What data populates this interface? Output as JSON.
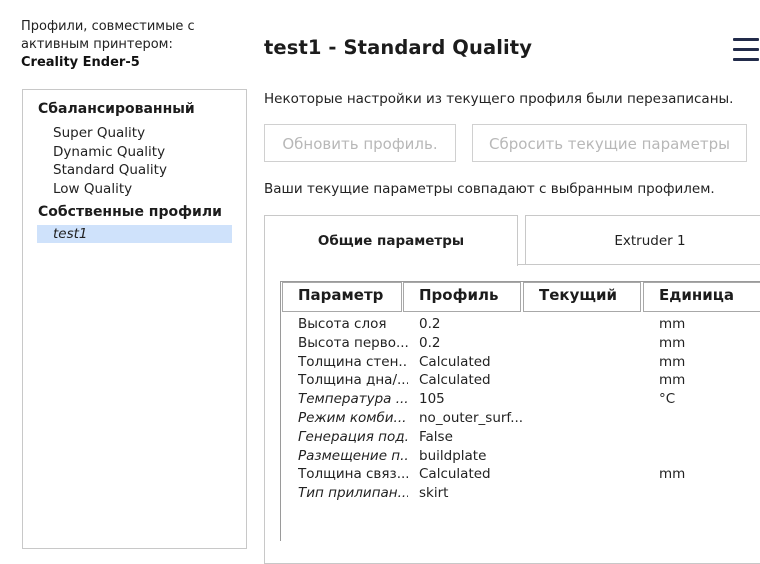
{
  "compat": {
    "line1": "Профили, совместимые с",
    "line2": "активным принтером:",
    "printer": "Creality Ender-5"
  },
  "profiles": {
    "groups": [
      {
        "title": "Сбалансированный",
        "items": [
          "Super Quality",
          "Dynamic Quality",
          "Standard Quality",
          "Low Quality"
        ]
      },
      {
        "title": "Собственные профили",
        "items": [
          "test1"
        ]
      }
    ],
    "selected": "test1"
  },
  "header": {
    "title": "test1 - Standard Quality",
    "menu_icon": "hamburger-menu-icon"
  },
  "notice": "Некоторые настройки из текущего профиля были перезаписаны.",
  "buttons": {
    "update": "Обновить профиль.",
    "reset": "Сбросить текущие параметры"
  },
  "match_text": "Ваши текущие параметры совпадают с выбранным профилем.",
  "tabs": [
    {
      "label": "Общие параметры",
      "active": true
    },
    {
      "label": "Extruder 1",
      "active": false
    }
  ],
  "table": {
    "headers": [
      "Параметр",
      "Профиль",
      "Текущий",
      "Единица"
    ],
    "rows": [
      {
        "param": "Высота слоя",
        "profile": "0.2",
        "current": "",
        "unit": "mm",
        "italic": false
      },
      {
        "param": "Высота перво...",
        "profile": "0.2",
        "current": "",
        "unit": "mm",
        "italic": false
      },
      {
        "param": "Толщина стен...",
        "profile": "Calculated",
        "current": "",
        "unit": "mm",
        "italic": false
      },
      {
        "param": "Толщина дна/...",
        "profile": "Calculated",
        "current": "",
        "unit": "mm",
        "italic": false
      },
      {
        "param": "Температура ...",
        "profile": "105",
        "current": "",
        "unit": "°C",
        "italic": true
      },
      {
        "param": "Режим комби...",
        "profile": "no_outer_surf...",
        "current": "",
        "unit": "",
        "italic": true
      },
      {
        "param": "Генерация под...",
        "profile": "False",
        "current": "",
        "unit": "",
        "italic": true
      },
      {
        "param": "Размещение п...",
        "profile": "buildplate",
        "current": "",
        "unit": "",
        "italic": true
      },
      {
        "param": "Толщина связ...",
        "profile": "Calculated",
        "current": "",
        "unit": "mm",
        "italic": false
      },
      {
        "param": "Тип прилипан...",
        "profile": "skirt",
        "current": "",
        "unit": "",
        "italic": true
      }
    ]
  },
  "colors": {
    "selection": "#cfe2fb",
    "menu_icon": "#222b4a",
    "disabled_text": "#b8b8b8"
  }
}
